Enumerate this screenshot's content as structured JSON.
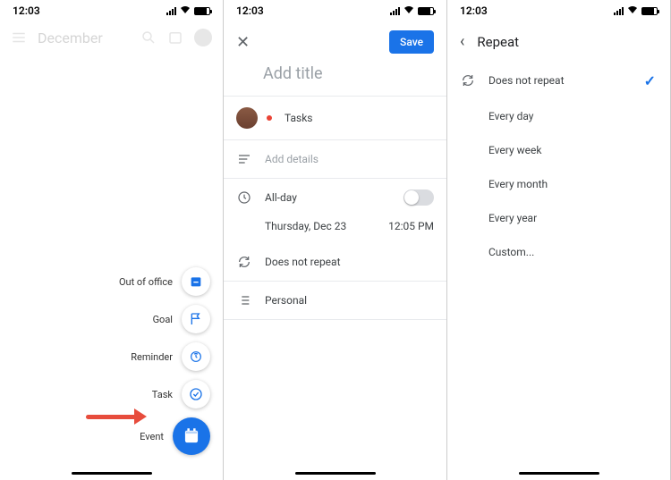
{
  "status": {
    "time": "12:03"
  },
  "screen1": {
    "month": "December",
    "fab": {
      "out_of_office": "Out of office",
      "goal": "Goal",
      "reminder": "Reminder",
      "task": "Task",
      "event": "Event"
    }
  },
  "screen2": {
    "save": "Save",
    "title_placeholder": "Add title",
    "tasks_label": "Tasks",
    "details_placeholder": "Add details",
    "allday_label": "All-day",
    "date": "Thursday, Dec 23",
    "time": "12:05 PM",
    "repeat": "Does not repeat",
    "list": "Personal"
  },
  "screen3": {
    "title": "Repeat",
    "options": {
      "none": "Does not repeat",
      "day": "Every day",
      "week": "Every week",
      "month": "Every month",
      "year": "Every year",
      "custom": "Custom..."
    }
  }
}
